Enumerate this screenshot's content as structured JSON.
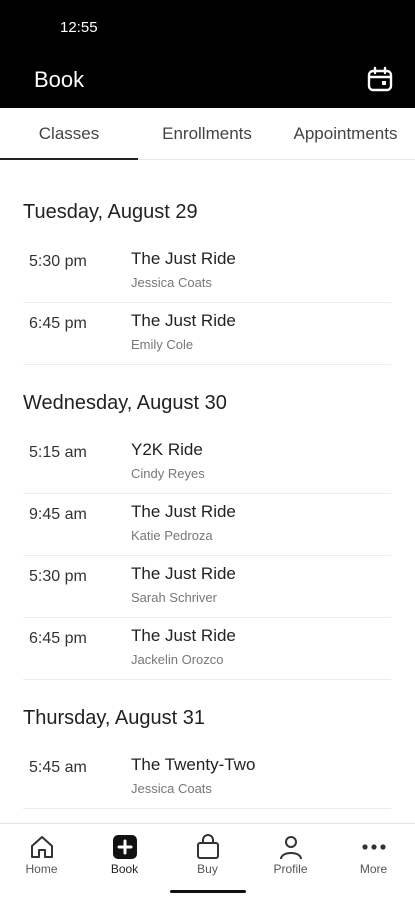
{
  "status_bar": {
    "time": "12:55"
  },
  "app_bar": {
    "title": "Book",
    "calendar_icon": "calendar-icon"
  },
  "tabs": [
    {
      "label": "Classes",
      "selected": true
    },
    {
      "label": "Enrollments",
      "selected": false
    },
    {
      "label": "Appointments",
      "selected": false
    }
  ],
  "schedule": [
    {
      "day": "Tuesday, August 29",
      "classes": [
        {
          "time": "5:30 pm",
          "name": "The Just Ride",
          "instructor": "Jessica Coats"
        },
        {
          "time": "6:45 pm",
          "name": "The Just Ride",
          "instructor": "Emily Cole"
        }
      ]
    },
    {
      "day": "Wednesday, August 30",
      "classes": [
        {
          "time": "5:15 am",
          "name": "Y2K Ride",
          "instructor": "Cindy Reyes"
        },
        {
          "time": "9:45 am",
          "name": "The Just Ride",
          "instructor": "Katie Pedroza"
        },
        {
          "time": "5:30 pm",
          "name": "The Just Ride",
          "instructor": "Sarah Schriver"
        },
        {
          "time": "6:45 pm",
          "name": "The Just Ride",
          "instructor": "Jackelin Orozco"
        }
      ]
    },
    {
      "day": "Thursday, August 31",
      "classes": [
        {
          "time": "5:45 am",
          "name": "The Twenty-Two",
          "instructor": "Jessica Coats"
        }
      ]
    }
  ],
  "bottom_nav": [
    {
      "label": "Home",
      "icon": "home-icon"
    },
    {
      "label": "Book",
      "icon": "plus-square-icon",
      "active": true
    },
    {
      "label": "Buy",
      "icon": "shopping-bag-icon"
    },
    {
      "label": "Profile",
      "icon": "person-icon"
    },
    {
      "label": "More",
      "icon": "more-dots-icon"
    }
  ]
}
